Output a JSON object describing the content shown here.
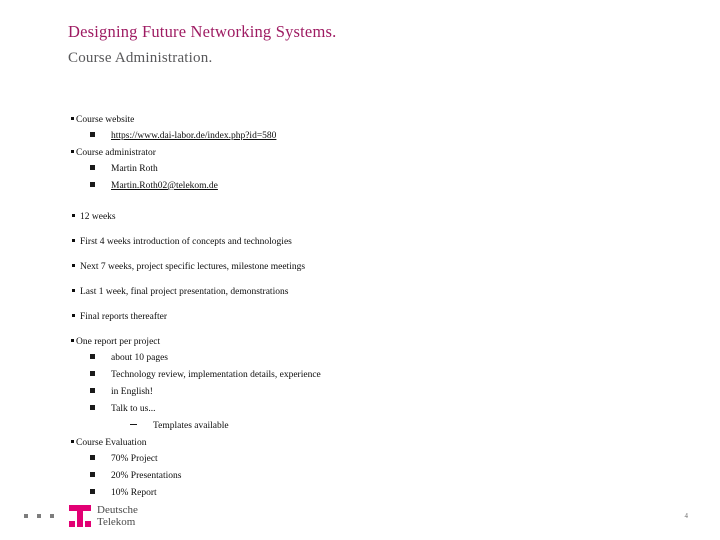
{
  "slide": {
    "title": "Designing Future Networking Systems.",
    "subtitle": "Course Administration.",
    "title_color": "#9E1B62",
    "subtitle_color": "#59595B",
    "page_number": "4"
  },
  "contact": {
    "website_label": "Course website",
    "website_url": "https://www.dai-labor.de/index.php?id=580",
    "admin_label": "Course administrator",
    "admin_name": "Martin Roth",
    "admin_email": "Martin.Roth02@telekom.de"
  },
  "schedule": {
    "items": [
      "12 weeks",
      "First 4 weeks introduction of concepts and technologies",
      "Next 7 weeks, project specific lectures, milestone meetings",
      "Last 1 week, final project presentation, demonstrations",
      "Final reports thereafter"
    ]
  },
  "report": {
    "heading": "One report per project",
    "items": [
      "about 10 pages",
      "Technology review, implementation details, experience",
      "in English!",
      "Talk to us..."
    ],
    "sub_item": "Templates available"
  },
  "evaluation": {
    "heading": "Course Evaluation",
    "items": [
      "70% Project",
      "20% Presentations",
      "10% Report"
    ]
  },
  "logo": {
    "line1": "Deutsche",
    "line2": "Telekom",
    "brand_color": "#E20074"
  }
}
